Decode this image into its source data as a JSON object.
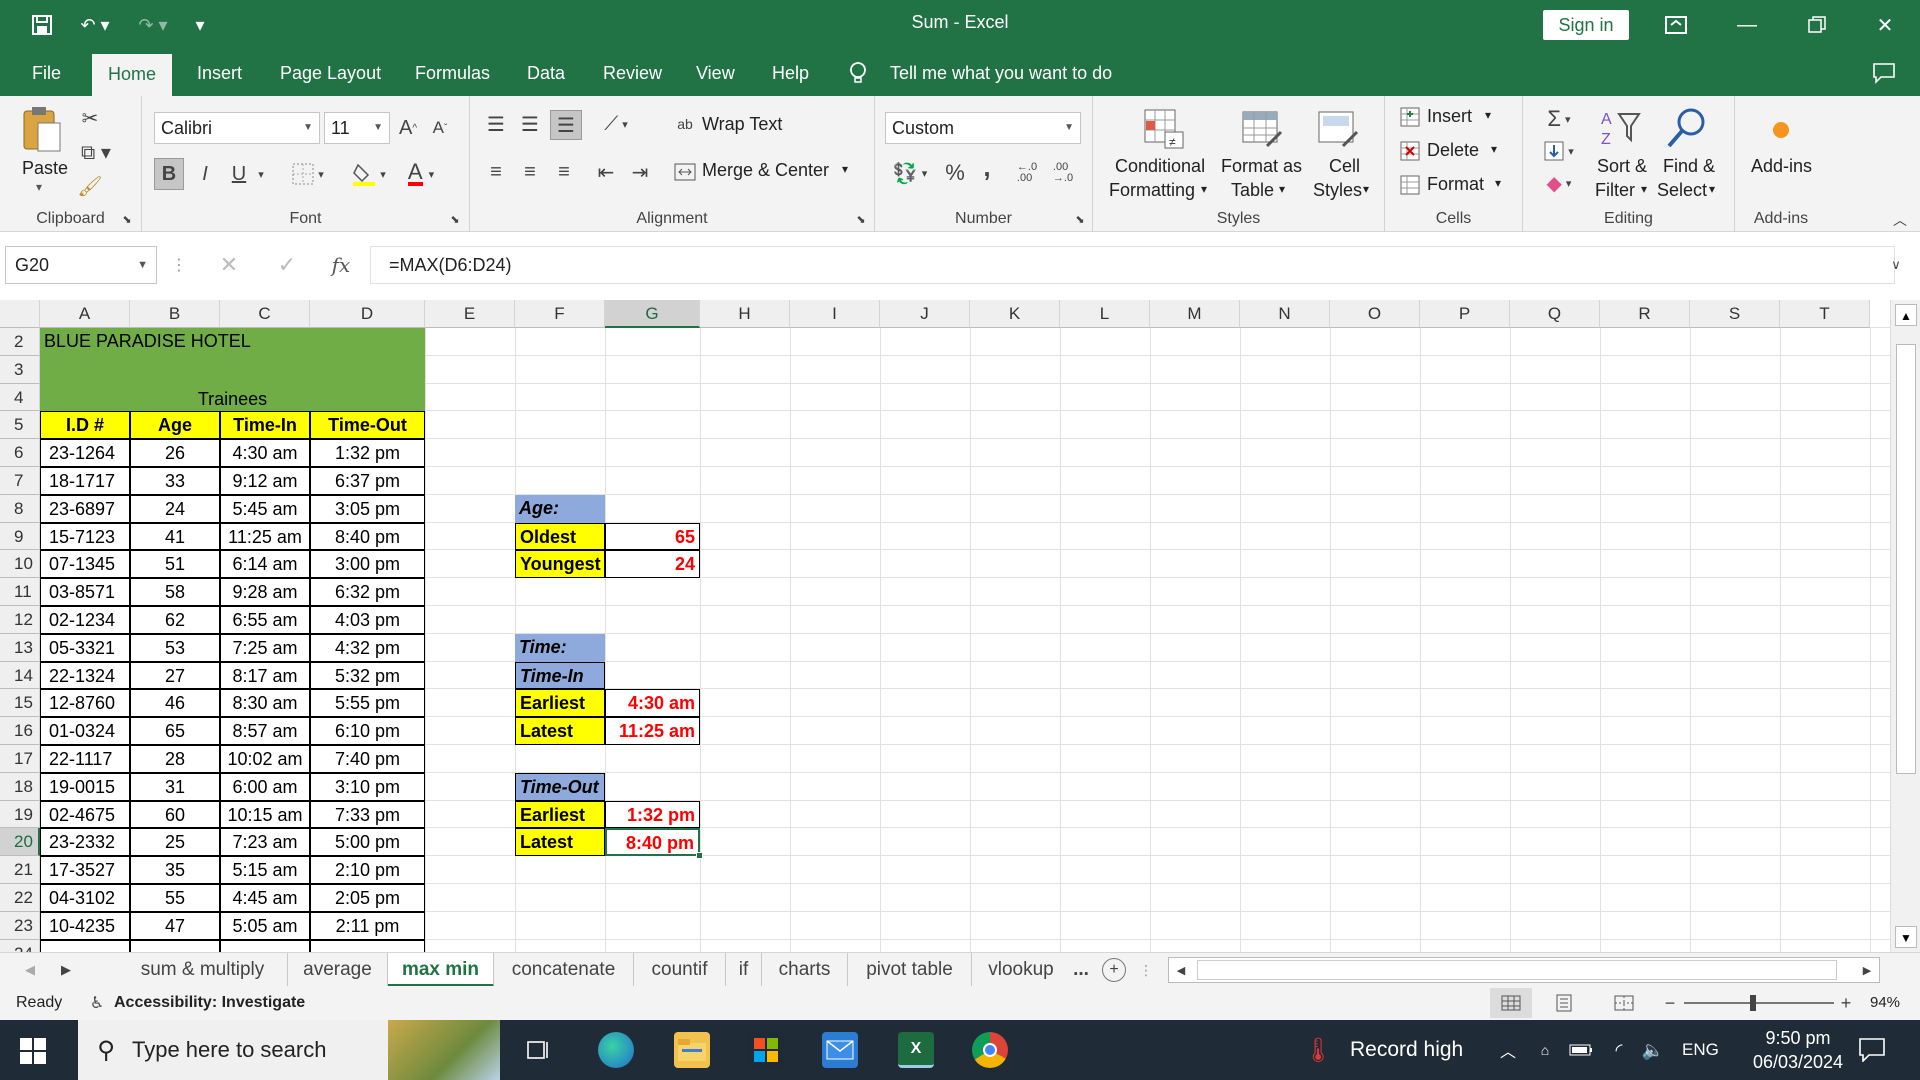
{
  "window": {
    "title": "Sum  -  Excel",
    "sign_in": "Sign in"
  },
  "menu": {
    "tabs": [
      "File",
      "Home",
      "Insert",
      "Page Layout",
      "Formulas",
      "Data",
      "Review",
      "View",
      "Help"
    ],
    "active": "Home",
    "tell_me": "Tell me what you want to do"
  },
  "ribbon": {
    "clipboard": {
      "label": "Clipboard",
      "paste": "Paste"
    },
    "font": {
      "label": "Font",
      "name": "Calibri",
      "size": "11",
      "bold": "B",
      "italic": "I",
      "underline": "U"
    },
    "alignment": {
      "label": "Alignment",
      "wrap": "Wrap Text",
      "merge": "Merge & Center"
    },
    "number": {
      "label": "Number",
      "format": "Custom",
      "percent": "%",
      "comma": ","
    },
    "styles": {
      "label": "Styles",
      "conditional_1": "Conditional",
      "conditional_2": "Formatting",
      "format_table_1": "Format as",
      "format_table_2": "Table",
      "cell_styles_1": "Cell",
      "cell_styles_2": "Styles"
    },
    "cells": {
      "label": "Cells",
      "insert": "Insert",
      "delete": "Delete",
      "format": "Format"
    },
    "editing": {
      "label": "Editing",
      "sort_1": "Sort &",
      "sort_2": "Filter",
      "find_1": "Find &",
      "find_2": "Select"
    },
    "addins": {
      "label": "Add-ins",
      "button": "Add-ins"
    }
  },
  "formula_bar": {
    "name_box": "G20",
    "fx": "fx",
    "formula": "=MAX(D6:D24)"
  },
  "grid": {
    "columns": [
      "A",
      "B",
      "C",
      "D",
      "E",
      "F",
      "G",
      "H",
      "I",
      "J",
      "K",
      "L",
      "M",
      "N",
      "O",
      "P",
      "Q",
      "R",
      "S",
      "T"
    ],
    "rows": [
      "2",
      "3",
      "4",
      "5",
      "6",
      "7",
      "8",
      "9",
      "10",
      "11",
      "12",
      "13",
      "14",
      "15",
      "16",
      "17",
      "18",
      "19",
      "20",
      "21",
      "22",
      "23",
      "24"
    ],
    "selected_column": "G",
    "selected_row": "20",
    "title": "BLUE PARADISE HOTEL",
    "subtitle": "Trainees",
    "table_headers": [
      "I.D #",
      "Age",
      "Time-In",
      "Time-Out"
    ],
    "table_rows": [
      [
        "23-1264",
        "26",
        "4:30 am",
        "1:32 pm"
      ],
      [
        "18-1717",
        "33",
        "9:12 am",
        "6:37 pm"
      ],
      [
        "23-6897",
        "24",
        "5:45 am",
        "3:05 pm"
      ],
      [
        "15-7123",
        "41",
        "11:25 am",
        "8:40 pm"
      ],
      [
        "07-1345",
        "51",
        "6:14 am",
        "3:00 pm"
      ],
      [
        "03-8571",
        "58",
        "9:28 am",
        "6:32 pm"
      ],
      [
        "02-1234",
        "62",
        "6:55 am",
        "4:03 pm"
      ],
      [
        "05-3321",
        "53",
        "7:25 am",
        "4:32 pm"
      ],
      [
        "22-1324",
        "27",
        "8:17 am",
        "5:32 pm"
      ],
      [
        "12-8760",
        "46",
        "8:30 am",
        "5:55 pm"
      ],
      [
        "01-0324",
        "65",
        "8:57 am",
        "6:10 pm"
      ],
      [
        "22-1117",
        "28",
        "10:02 am",
        "7:40 pm"
      ],
      [
        "19-0015",
        "31",
        "6:00 am",
        "3:10 pm"
      ],
      [
        "02-4675",
        "60",
        "10:15 am",
        "7:33 pm"
      ],
      [
        "23-2332",
        "25",
        "7:23 am",
        "5:00 pm"
      ],
      [
        "17-3527",
        "35",
        "5:15 am",
        "2:10 pm"
      ],
      [
        "04-3102",
        "55",
        "4:45 am",
        "2:05 pm"
      ],
      [
        "10-4235",
        "47",
        "5:05 am",
        "2:11 pm"
      ]
    ],
    "summary": {
      "age_header": "Age:",
      "oldest_label": "Oldest",
      "oldest_value": "65",
      "youngest_label": "Youngest",
      "youngest_value": "24",
      "time_header": "Time:",
      "time_in_header": "Time-In",
      "in_earliest_label": "Earliest",
      "in_earliest_value": "4:30 am",
      "in_latest_label": "Latest",
      "in_latest_value": "11:25 am",
      "time_out_header": "Time-Out",
      "out_earliest_label": "Earliest",
      "out_earliest_value": "1:32 pm",
      "out_latest_label": "Latest",
      "out_latest_value": "8:40 pm"
    }
  },
  "sheets": {
    "tabs": [
      "sum & multiply",
      "average",
      "max min",
      "concatenate",
      "countif",
      "if",
      "charts",
      "pivot table",
      "vlookup"
    ],
    "active": "max min",
    "more": "..."
  },
  "status": {
    "ready": "Ready",
    "accessibility": "Accessibility: Investigate",
    "zoom": "94%"
  },
  "taskbar": {
    "search_placeholder": "Type here to search",
    "weather": "Record high",
    "lang": "ENG",
    "time": "9:50 pm",
    "date": "06/03/2024"
  },
  "colors": {
    "excel_green": "#217346",
    "title_fill": "#70ad47",
    "header_yellow": "#ffff00",
    "summary_blue": "#8ea9db",
    "value_red": "#ff0000"
  }
}
